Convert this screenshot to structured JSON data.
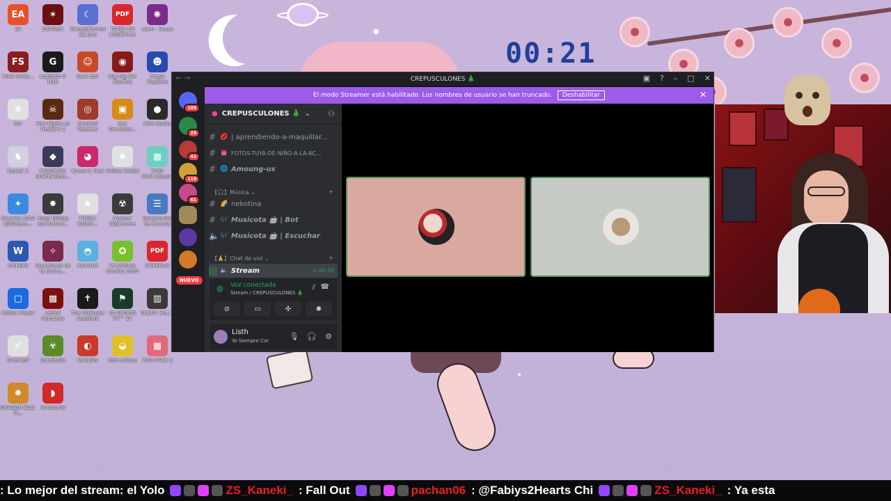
{
  "desktop": {
    "icons": [
      {
        "label": "EA",
        "glyph": "EA",
        "color": "#e8502a"
      },
      {
        "label": "DEVOUR",
        "glyph": "✶",
        "color": "#6a1010"
      },
      {
        "label": "StreamElements SE.Live",
        "glyph": "☾",
        "color": "#5a6fd0"
      },
      {
        "label": "TAREA DE LISSETH.m",
        "glyph": "PDF",
        "color": "#d9262b"
      },
      {
        "label": "eden - Acces",
        "glyph": "✺",
        "color": "#7a2a8a"
      },
      {
        "label": "Final Sente...",
        "glyph": "FS",
        "color": "#8a1e1e"
      },
      {
        "label": "Logitech G HUB",
        "glyph": "G",
        "color": "#1a1a1a"
      },
      {
        "label": "Suck Up!",
        "glyph": "☺",
        "color": "#c84a2a"
      },
      {
        "label": "Dig Dig Die PlayTest",
        "glyph": "◉",
        "color": "#8a1a1a"
      },
      {
        "label": "Poppy Playtime",
        "glyph": "☻",
        "color": "#2a4ab0"
      },
      {
        "label": "flor",
        "glyph": "❀",
        "color": "#e0e0e0"
      },
      {
        "label": "Five Nights at Freddy's 2",
        "glyph": "☠",
        "color": "#5a2a10"
      },
      {
        "label": "Chained Together",
        "glyph": "◎",
        "color": "#a03a2a"
      },
      {
        "label": "Bus Simulator...",
        "glyph": "▣",
        "color": "#d88a1a"
      },
      {
        "label": "OBS Studio",
        "glyph": "●",
        "color": "#2a2a2a"
      },
      {
        "label": "Deceit 2",
        "glyph": "♞",
        "color": "#d0d0e0"
      },
      {
        "label": "PRAGMATA SKETCHBOO...",
        "glyph": "◆",
        "color": "#3a3a5a"
      },
      {
        "label": "Bread & Fred",
        "glyph": "◕",
        "color": "#c82a6a"
      },
      {
        "label": "Hollow Knight",
        "glyph": "♠",
        "color": "#e0e0e0"
      },
      {
        "label": "PICO PARK:Classic",
        "glyph": "▦",
        "color": "#6ad0c0"
      },
      {
        "label": "Encanta 2023 Biblioteca...",
        "glyph": "✦",
        "color": "#3a8ae0"
      },
      {
        "label": "Keep Talking and Nobod...",
        "glyph": "✸",
        "color": "#3a3a3a"
      },
      {
        "label": "Hollow Knight...",
        "glyph": "♠",
        "color": "#e0e0e0"
      },
      {
        "label": "Nuclear Nightmare",
        "glyph": "☢",
        "color": "#3a3a3a"
      },
      {
        "label": "Diccionarios de Encarta",
        "glyph": "☰",
        "color": "#4a7ac0"
      },
      {
        "label": "STIKERS",
        "glyph": "W",
        "color": "#2a5ab0"
      },
      {
        "label": "Guardianes de la Noche...",
        "glyph": "✧",
        "color": "#7a2a4a"
      },
      {
        "label": "Palworld",
        "glyph": "◓",
        "color": "#5ab0e0"
      },
      {
        "label": "Mi primera Encarta 2009",
        "glyph": "✪",
        "color": "#7ac02a"
      },
      {
        "label": "STIKERLIS",
        "glyph": "PDF",
        "color": "#d9262b"
      },
      {
        "label": "Roblox Player",
        "glyph": "▢",
        "color": "#1a6ae0"
      },
      {
        "label": "Lethal Company",
        "glyph": "▩",
        "color": "#7a1010"
      },
      {
        "label": "The Mortuary Assistant",
        "glyph": "✝",
        "color": "#1a1a1a"
      },
      {
        "label": "EA SPORTS FC™ 24",
        "glyph": "⚑",
        "color": "#1a3a2a"
      },
      {
        "label": "SILENT HILL 2",
        "glyph": "▥",
        "color": "#3a3a3a"
      },
      {
        "label": "Overwolf",
        "glyph": "✐",
        "color": "#e0e0e0"
      },
      {
        "label": "Brawlhalla",
        "glyph": "☣",
        "color": "#5a8a2a"
      },
      {
        "label": "MIMESIS",
        "glyph": "◐",
        "color": "#c83a2a"
      },
      {
        "label": "Pain-a-Duce",
        "glyph": "◒",
        "color": "#e0c02a"
      },
      {
        "label": "PICO PARK 2",
        "glyph": "▦",
        "color": "#e06a7a"
      },
      {
        "label": "DRAGON BALL FI...",
        "glyph": "✹",
        "color": "#d08a2a"
      },
      {
        "label": "Among Us",
        "glyph": "◗",
        "color": "#d02a2a"
      }
    ]
  },
  "timer": "00:21",
  "discord": {
    "window_title": "CREPUSCULONES 🎄",
    "banner": {
      "text": "El modo Streamer está habilitado. Los nombres de usuario se han truncado.",
      "button": "Deshabilitar"
    },
    "guild_badges": [
      "109",
      "29",
      "42",
      "118",
      "61"
    ],
    "nuevo": "NUEVO",
    "server_name": "CREPUSCULONES 🎄",
    "channels": [
      {
        "icon": "💋",
        "name": "| aprendiendo-a-maquillar..."
      },
      {
        "icon": "👅",
        "name": "FOTOS-TUYA-DE-NIÑO-A-LA-AC..."
      },
      {
        "icon": "🌐",
        "name": "Amoung-us"
      }
    ],
    "category_music": "Música",
    "music_channels": [
      {
        "icon": "🌈",
        "name": "nekotina"
      },
      {
        "icon": "🎶",
        "name": "Musicota 🤖 | Bot"
      },
      {
        "icon": "🎶",
        "name": "Musicota 🤖 | Escuchar"
      }
    ],
    "category_voice": "Chat de voz",
    "stream_channel": {
      "name": "Stream",
      "time": "1:04:53"
    },
    "voice": {
      "status": "Voz conectada",
      "sub": "Stream / CREPUSCULONES 🎄"
    },
    "user": {
      "name": "Listh",
      "status": "Yo Siempre Cor"
    },
    "tiles": [
      {
        "bg": "#d9a89f"
      },
      {
        "bg": "#c5cbc4"
      }
    ]
  },
  "ticker": {
    "items": [
      {
        "type": "text",
        "text": ": Lo mejor del stream: el Yolo"
      },
      {
        "type": "user",
        "text": "ZS_Kaneki_"
      },
      {
        "type": "text",
        "text": ": Fall Out"
      },
      {
        "type": "user",
        "text": "pachan06"
      },
      {
        "type": "text",
        "text": ": @Fabiys2Hearts Chi"
      },
      {
        "type": "user",
        "text": "ZS_Kaneki_"
      },
      {
        "type": "text",
        "text": ": Ya esta"
      }
    ]
  }
}
